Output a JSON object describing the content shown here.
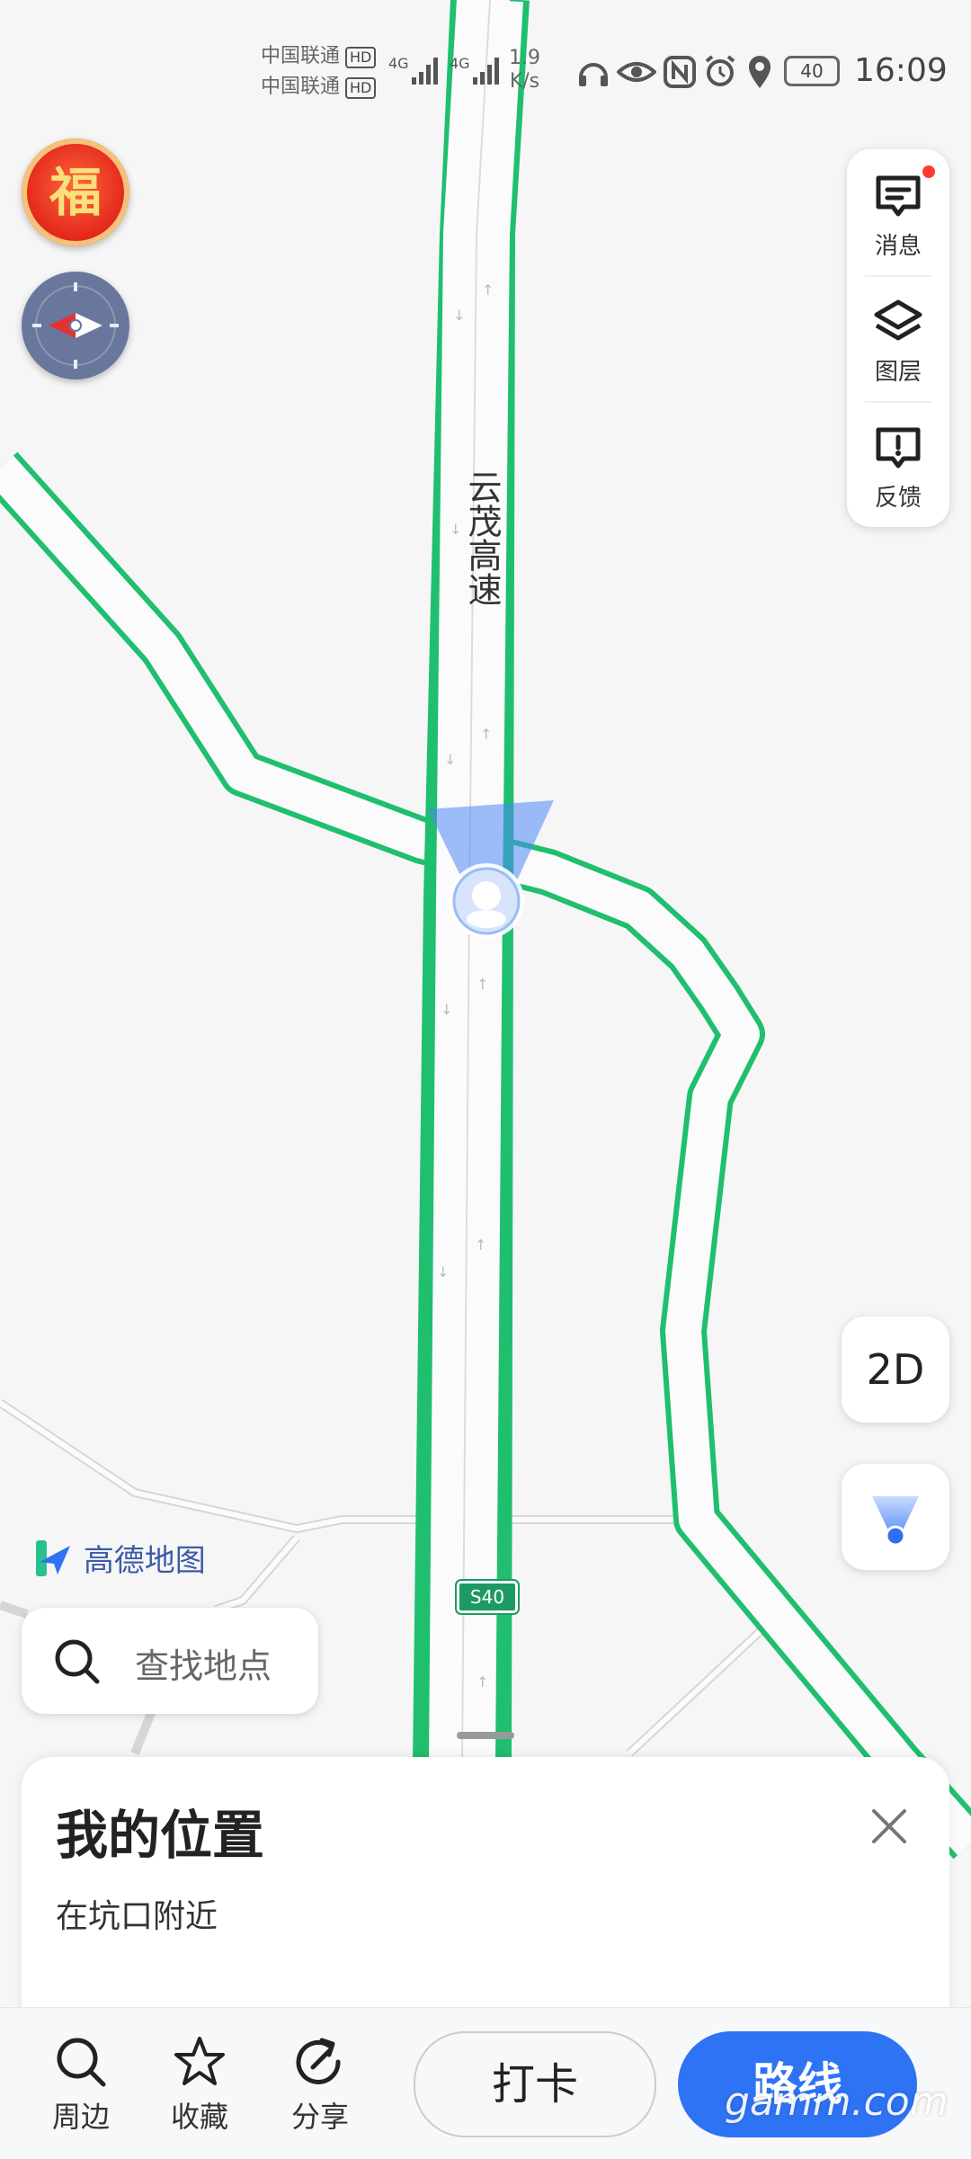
{
  "status_bar": {
    "carrier_1": "中国联通",
    "carrier_2": "中国联通",
    "hd_1": "HD",
    "hd_2": "HD",
    "net_1": "4G",
    "net_2": "4G",
    "speed_value": "1.9",
    "speed_unit": "K/s",
    "battery": "40",
    "time": "16:09"
  },
  "map": {
    "road_name": "云茂高速",
    "road_shield": "S40",
    "logo_text": "高德地图"
  },
  "side_panel": {
    "messages_label": "消息",
    "layers_label": "图层",
    "feedback_label": "反馈"
  },
  "view_mode": "2D",
  "lucky_badge": "福",
  "search": {
    "placeholder": "查找地点"
  },
  "location_card": {
    "title": "我的位置",
    "subtitle": "在坑口附近"
  },
  "bottom_bar": {
    "nearby": "周边",
    "favorite": "收藏",
    "share": "分享",
    "checkin": "打卡",
    "route": "路线"
  },
  "watermark": "gamm.com",
  "colors": {
    "road_outline": "#1fbf6f",
    "accent_blue": "#2f73f5",
    "compass_bg": "#69779c"
  }
}
